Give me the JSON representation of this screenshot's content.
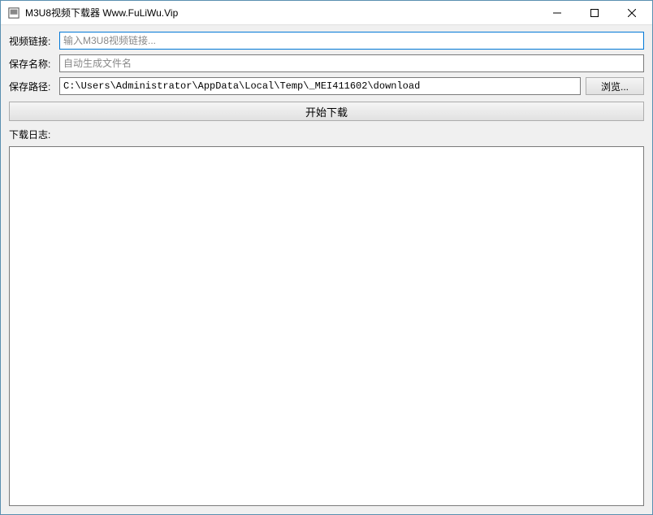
{
  "window": {
    "title": "M3U8视频下载器 Www.FuLiWu.Vip"
  },
  "form": {
    "video_url": {
      "label": "视频链接:",
      "placeholder": "输入M3U8视频链接...",
      "value": ""
    },
    "save_name": {
      "label": "保存名称:",
      "placeholder": "自动生成文件名",
      "value": ""
    },
    "save_path": {
      "label": "保存路径:",
      "value": "C:\\Users\\Administrator\\AppData\\Local\\Temp\\_MEI411602\\download"
    },
    "browse_label": "浏览...",
    "start_label": "开始下载",
    "log_label": "下载日志:"
  }
}
